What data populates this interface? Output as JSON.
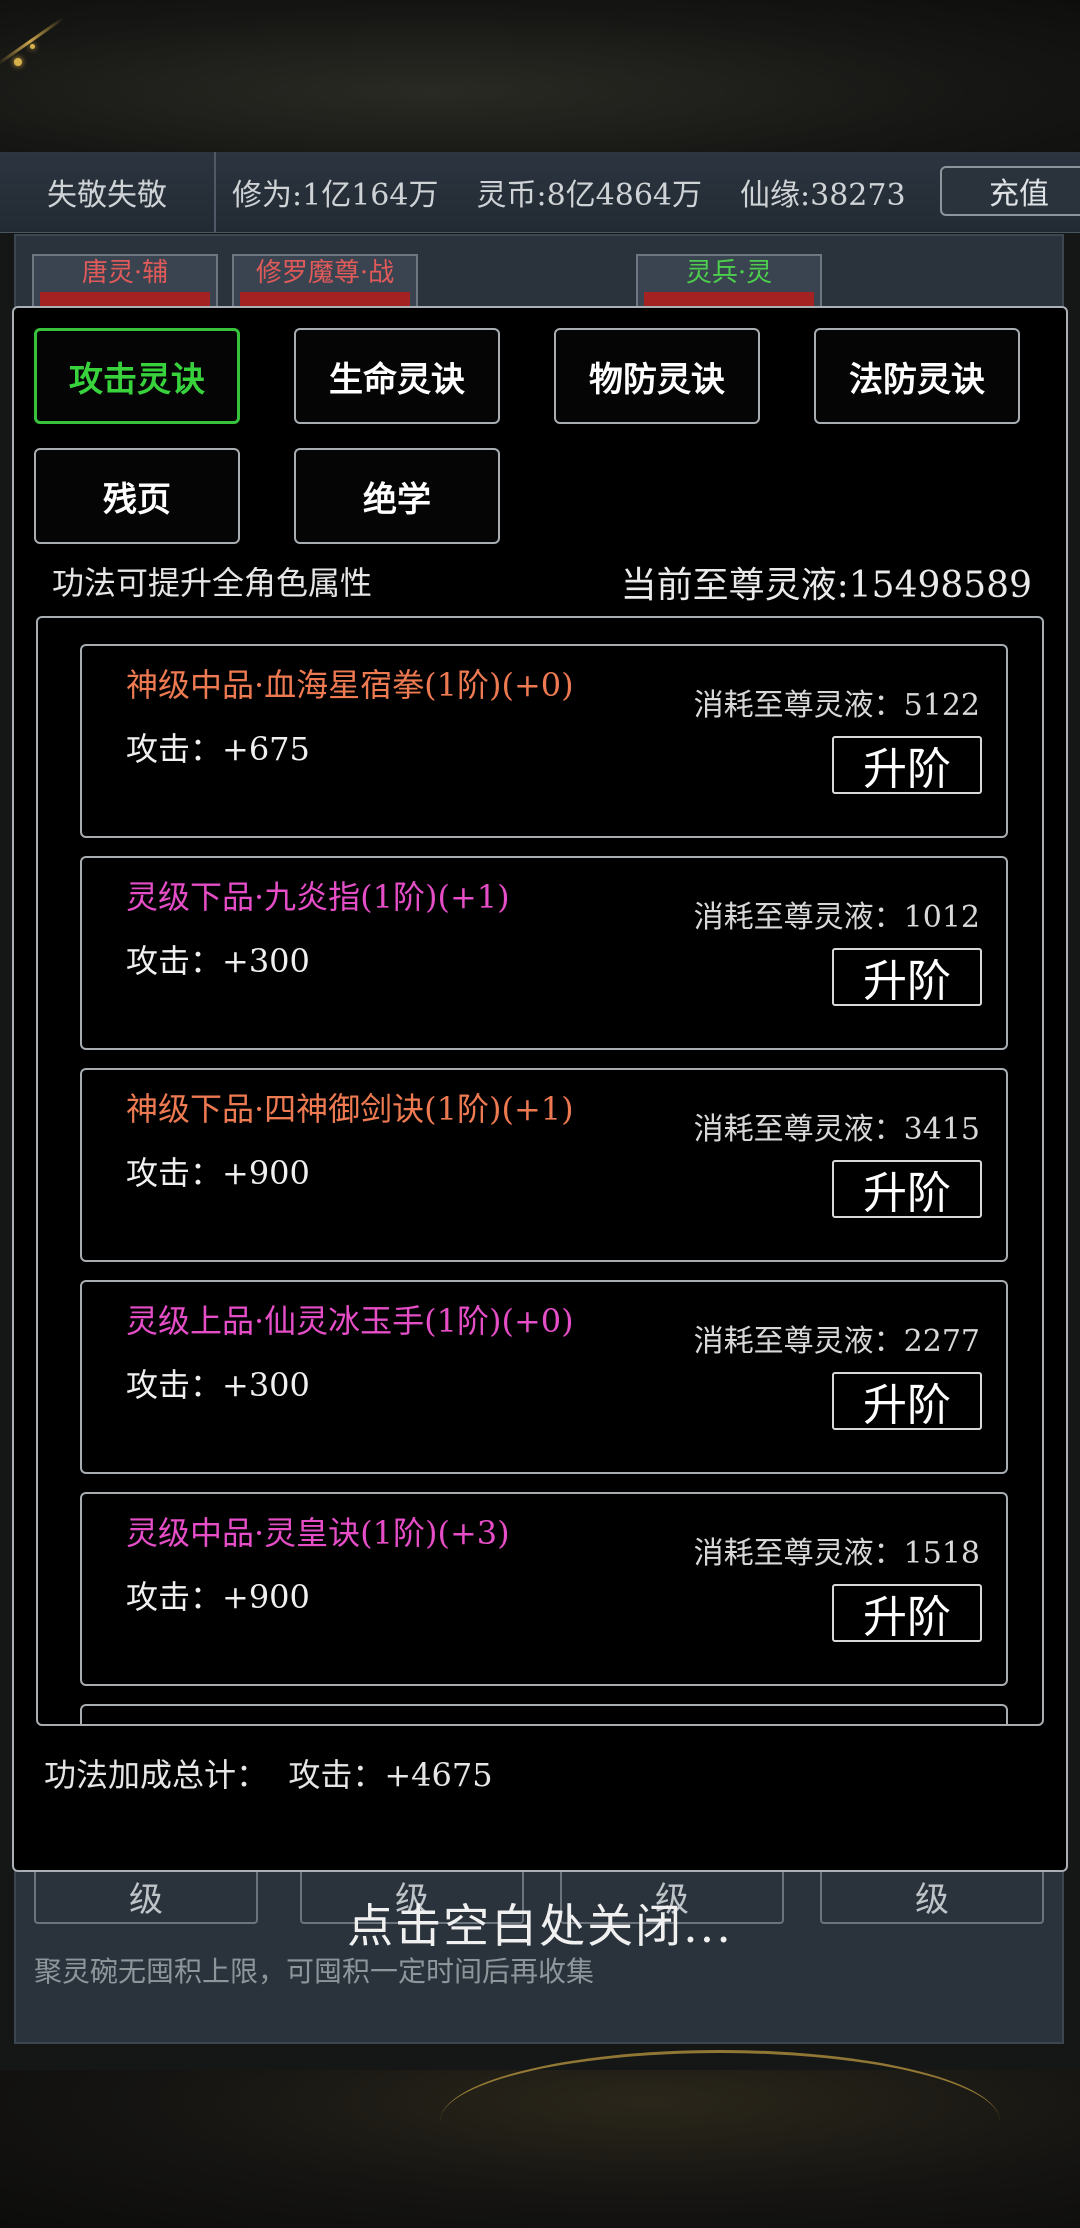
{
  "top_bar": {
    "player": "失敬失敬",
    "stats": [
      "修为:1亿164万",
      "灵币:8亿4864万",
      "仙缘:38273"
    ],
    "recharge": "充值"
  },
  "background": {
    "roles": [
      {
        "name": "唐灵·辅",
        "color": "#e05a5a"
      },
      {
        "name": "修罗魔尊·战",
        "color": "#e05a5a"
      },
      {
        "name": "灵兵·灵",
        "color": "#4ccf4c"
      }
    ],
    "levels": [
      "级",
      "级",
      "级",
      "级"
    ],
    "hint": "聚灵碗无囤积上限，可囤积一定时间后再收集"
  },
  "modal": {
    "tabs": [
      "攻击灵诀",
      "生命灵诀",
      "物防灵诀",
      "法防灵诀",
      "残页",
      "绝学"
    ],
    "active_tab": 0,
    "subtitle": "功法可提升全角色属性",
    "liquid": "当前至尊灵液:15498589",
    "skills": [
      {
        "name": "神级中品·血海星宿拳(1阶)(+0)",
        "grade": "shen",
        "attack": "攻击：+675",
        "cost": "消耗至尊灵液：5122",
        "button": "升阶"
      },
      {
        "name": "灵级下品·九炎指(1阶)(+1)",
        "grade": "ling",
        "attack": "攻击：+300",
        "cost": "消耗至尊灵液：1012",
        "button": "升阶"
      },
      {
        "name": "神级下品·四神御剑诀(1阶)(+1)",
        "grade": "shen",
        "attack": "攻击：+900",
        "cost": "消耗至尊灵液：3415",
        "button": "升阶"
      },
      {
        "name": "灵级上品·仙灵冰玉手(1阶)(+0)",
        "grade": "ling",
        "attack": "攻击：+300",
        "cost": "消耗至尊灵液：2277",
        "button": "升阶"
      },
      {
        "name": "灵级中品·灵皇诀(1阶)(+3)",
        "grade": "ling",
        "attack": "攻击：+900",
        "cost": "消耗至尊灵液：1518",
        "button": "升阶"
      }
    ],
    "total_label": "功法加成总计：",
    "total_value": "攻击：+4675"
  },
  "close_hint": "点击空白处关闭..."
}
